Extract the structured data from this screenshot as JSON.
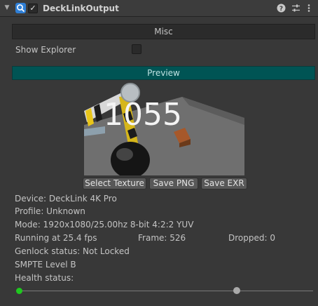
{
  "component": {
    "title": "DeckLinkOutput",
    "enabled": "✓",
    "help_icon": "?",
    "presets_icon": "⇅",
    "menu_icon": "⋮"
  },
  "misc": {
    "header": "Misc",
    "show_explorer_label": "Show Explorer",
    "show_explorer_checked": false
  },
  "preview": {
    "header": "Preview",
    "overlay_text": "1055",
    "buttons": {
      "select_texture": "Select Texture",
      "save_png": "Save PNG",
      "save_exr": "Save EXR"
    }
  },
  "info": {
    "device": "Device: DeckLink 4K Pro",
    "profile": "Profile: Unknown",
    "mode": "Mode: 1920x1080/25.00hz 8-bit 4:2:2 YUV",
    "running": "Running at 25.4 fps",
    "frame": "Frame: 526",
    "dropped": "Dropped: 0",
    "genlock": "Genlock status: Not Locked",
    "smpte": "SMPTE Level B",
    "health": "Health status:"
  },
  "health_slider": {
    "fraction": 0.74,
    "indicator_color": "#1fc81f"
  },
  "colors": {
    "preview_accent": "#005454",
    "panel_bg": "#383838"
  }
}
